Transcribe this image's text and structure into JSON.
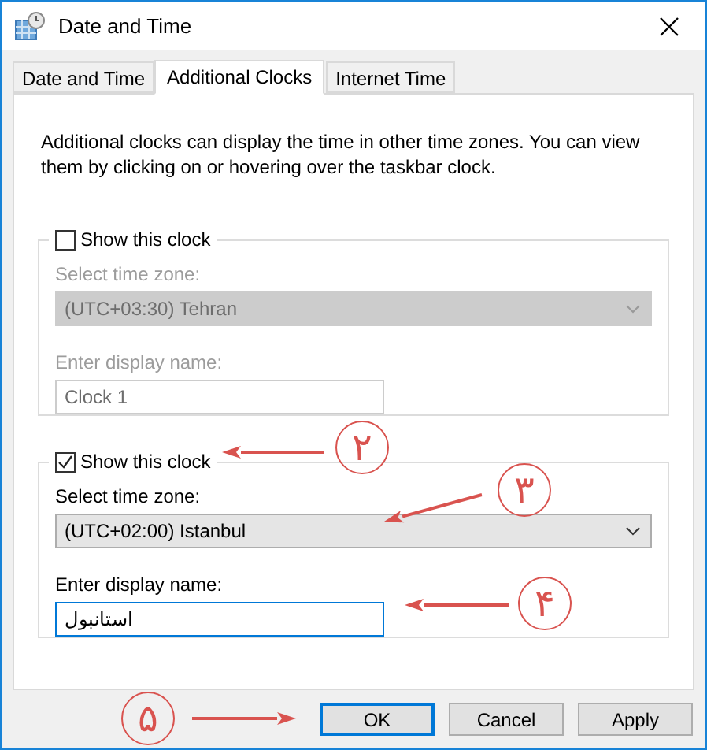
{
  "window": {
    "title": "Date and Time"
  },
  "tabs": [
    {
      "label": "Date and Time",
      "selected": false
    },
    {
      "label": "Additional Clocks",
      "selected": true
    },
    {
      "label": "Internet Time",
      "selected": false
    }
  ],
  "description": "Additional clocks can display the time in other time zones. You can view them by clicking on or hovering over the taskbar clock.",
  "clocks": [
    {
      "show_label": "Show this clock",
      "checked": false,
      "disabled": true,
      "zone_label": "Select time zone:",
      "zone": "(UTC+03:30) Tehran",
      "name_label": "Enter display name:",
      "name": "Clock 1",
      "focused": false
    },
    {
      "show_label": "Show this clock",
      "checked": true,
      "disabled": false,
      "zone_label": "Select time zone:",
      "zone": "(UTC+02:00) Istanbul",
      "name_label": "Enter display name:",
      "name": "استانبول",
      "focused": true
    }
  ],
  "buttons": [
    {
      "label": "OK",
      "default": true
    },
    {
      "label": "Cancel",
      "default": false
    },
    {
      "label": "Apply",
      "default": false
    }
  ],
  "annotations": [
    {
      "label": "۲"
    },
    {
      "label": "۳"
    },
    {
      "label": "۴"
    },
    {
      "label": "۵"
    }
  ]
}
